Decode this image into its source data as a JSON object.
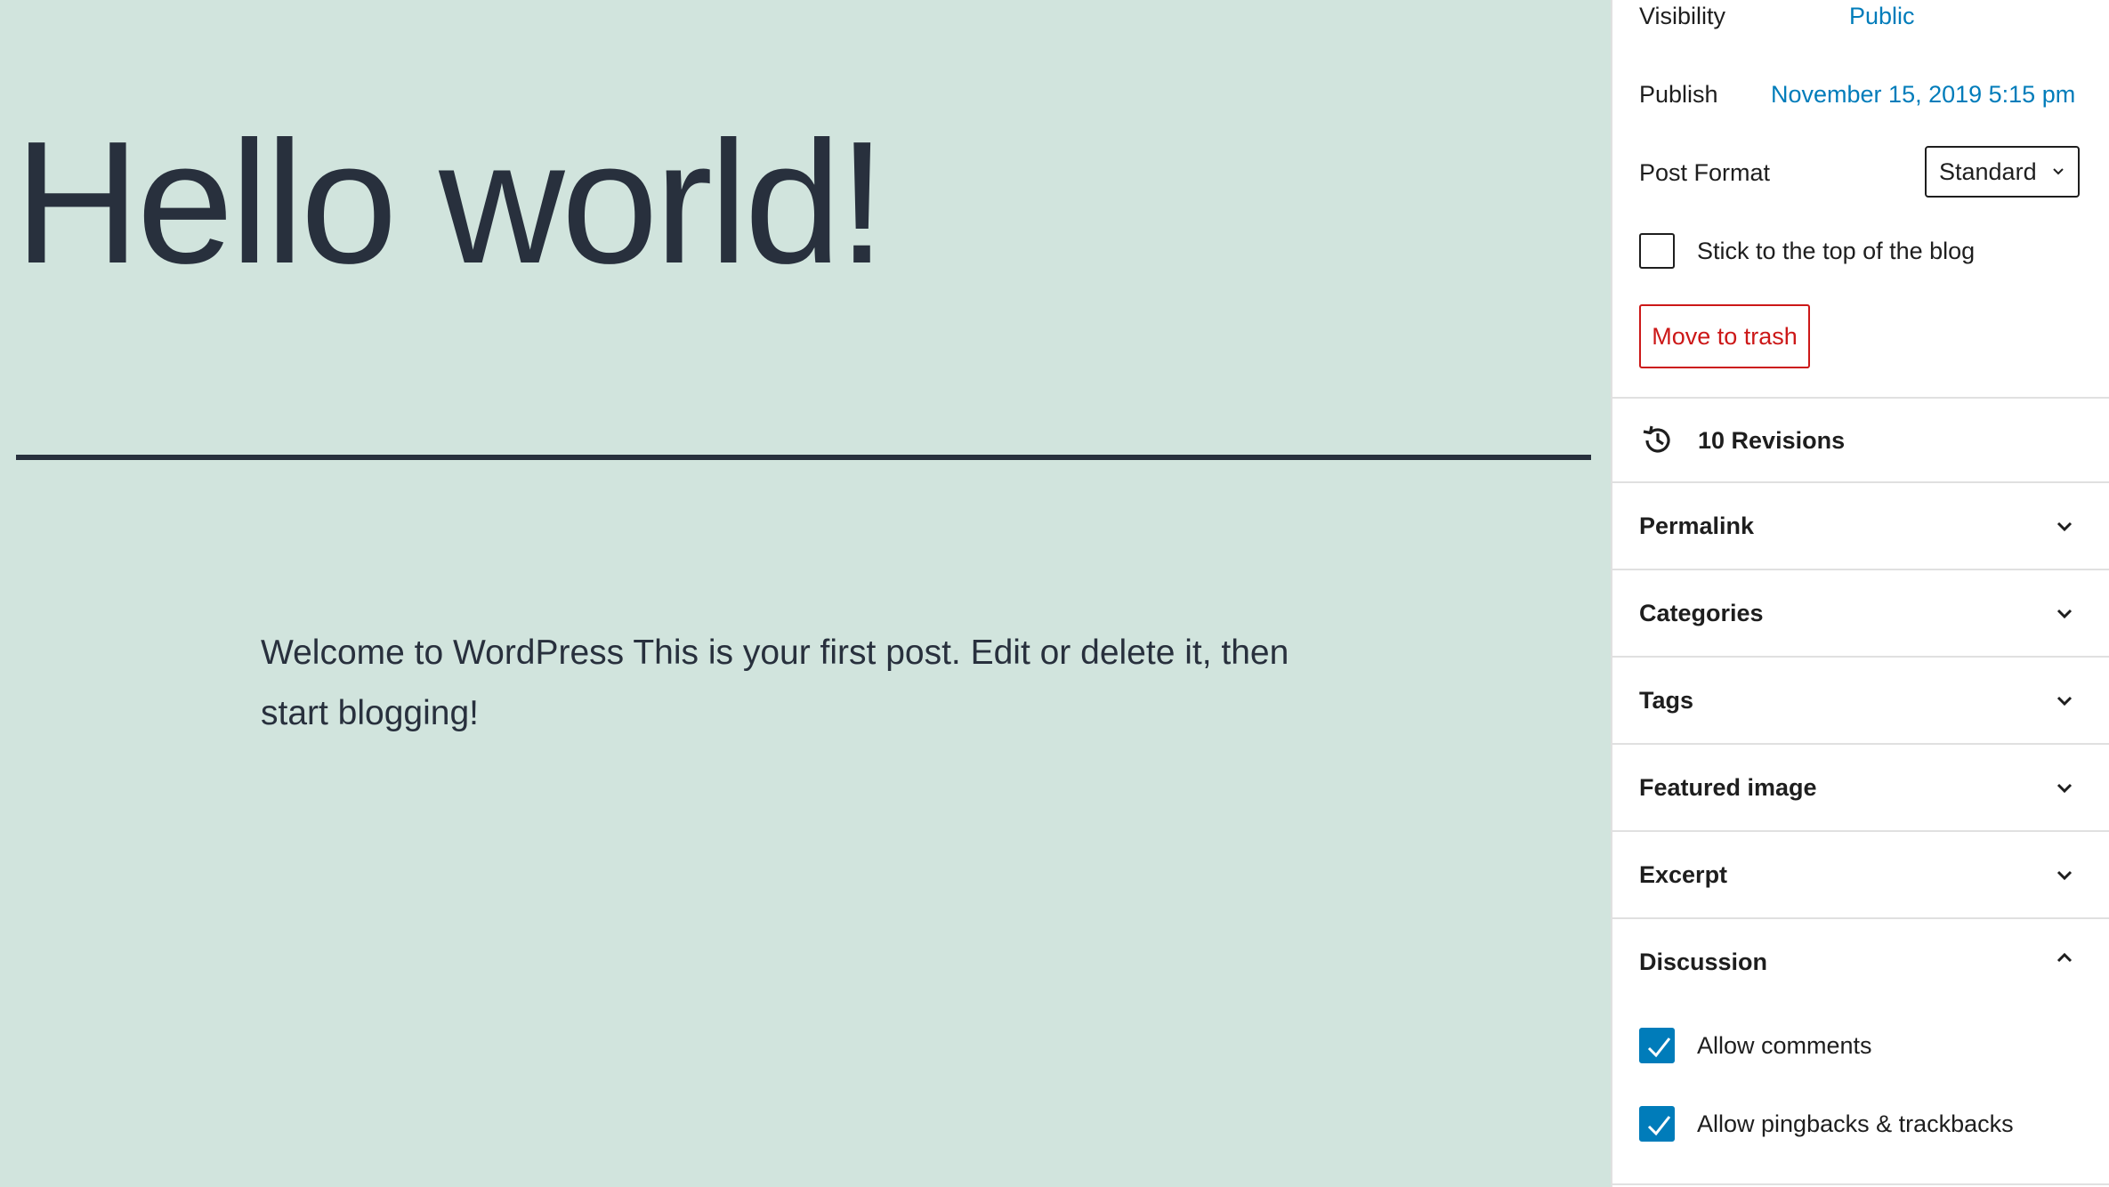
{
  "editor": {
    "title": "Hello world!",
    "body": "Welcome to WordPress This is your first post. Edit or delete it, then start blogging!"
  },
  "sidebar": {
    "visibility": {
      "label": "Visibility",
      "value": "Public"
    },
    "publish": {
      "label": "Publish",
      "value": "November 15, 2019 5:15 pm"
    },
    "post_format": {
      "label": "Post Format",
      "selected": "Standard"
    },
    "sticky": {
      "label": "Stick to the top of the blog",
      "checked": false
    },
    "trash_label": "Move to trash",
    "revisions": {
      "label": "10 Revisions",
      "icon": "history-icon"
    },
    "panels": [
      {
        "label": "Permalink",
        "expanded": false
      },
      {
        "label": "Categories",
        "expanded": false
      },
      {
        "label": "Tags",
        "expanded": false
      },
      {
        "label": "Featured image",
        "expanded": false
      },
      {
        "label": "Excerpt",
        "expanded": false
      },
      {
        "label": "Discussion",
        "expanded": true
      }
    ],
    "discussion": {
      "allow_comments": {
        "label": "Allow comments",
        "checked": true
      },
      "allow_pingbacks": {
        "label": "Allow pingbacks & trackbacks",
        "checked": true
      }
    }
  },
  "colors": {
    "editor_background": "#d1e4dd",
    "text_dark": "#28303d",
    "link": "#007cba",
    "destructive": "#cc1818"
  }
}
